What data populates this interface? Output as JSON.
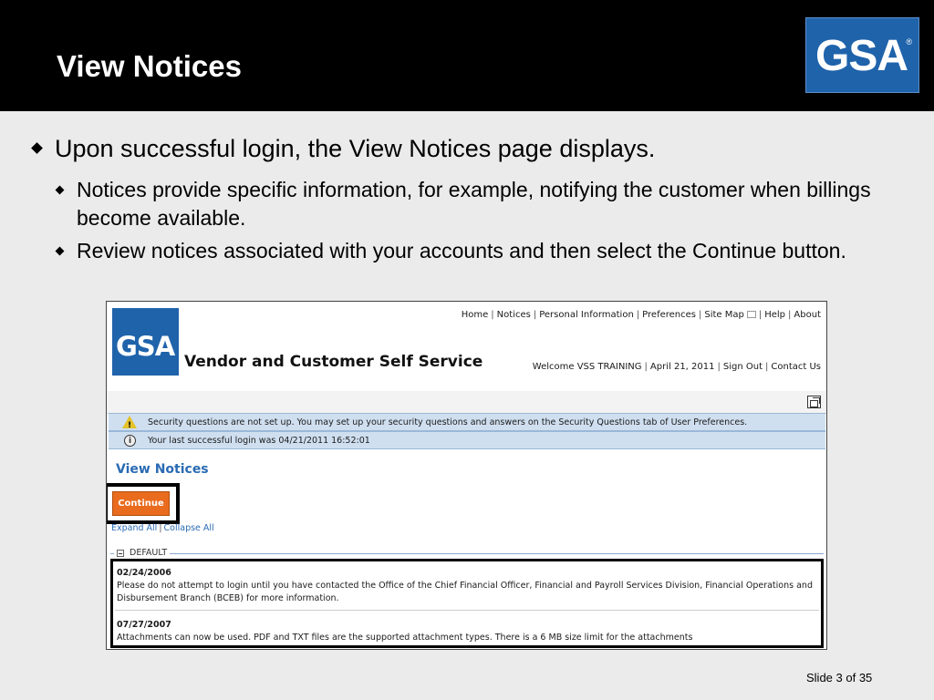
{
  "slide": {
    "title": "View Notices",
    "logo_text": "GSA",
    "logo_reg": "®",
    "footer": "Slide 3 of 35"
  },
  "bullets": [
    {
      "level": 1,
      "text": "Upon successful login, the View Notices page displays."
    },
    {
      "level": 2,
      "text": "Notices provide specific information, for example, notifying the customer when billings become available."
    },
    {
      "level": 2,
      "text": "Review notices associated with your accounts and then select the Continue button."
    }
  ],
  "app": {
    "logo_text": "GSA",
    "title": "Vendor and Customer Self Service",
    "nav": [
      "Home",
      "Notices",
      "Personal Information",
      "Preferences",
      "Site Map",
      "Help",
      "About"
    ],
    "welcome": [
      "Welcome VSS TRAINING",
      "April 21, 2011",
      "Sign Out",
      "Contact Us"
    ],
    "messages": [
      {
        "icon": "warning-icon",
        "text": "Security questions are not set up. You may set up your security questions and answers on the Security Questions tab of User Preferences."
      },
      {
        "icon": "info-icon",
        "text": "Your last successful login was 04/21/2011 16:52:01"
      }
    ],
    "page_heading": "View Notices",
    "continue_label": "Continue",
    "expand_all": "Expand All",
    "collapse_all": "Collapse All",
    "group_label": "DEFAULT",
    "notices": [
      {
        "date": "02/24/2006",
        "text": "Please do not attempt to login until you have contacted the Office of the Chief Financial Officer, Financial and Payroll Services Division, Financial Operations and Disbursement Branch (BCEB) for more information."
      },
      {
        "date": "07/27/2007",
        "text": "Attachments can now be used. PDF and TXT files are the supported attachment types. There is a 6 MB size limit for the attachments"
      }
    ]
  },
  "colors": {
    "header_bg": "#000000",
    "logo_blue": "#1f63ab",
    "heading_blue": "#2a6bb3",
    "message_bg": "#cfdff0",
    "continue_orange": "#e96b1e"
  }
}
